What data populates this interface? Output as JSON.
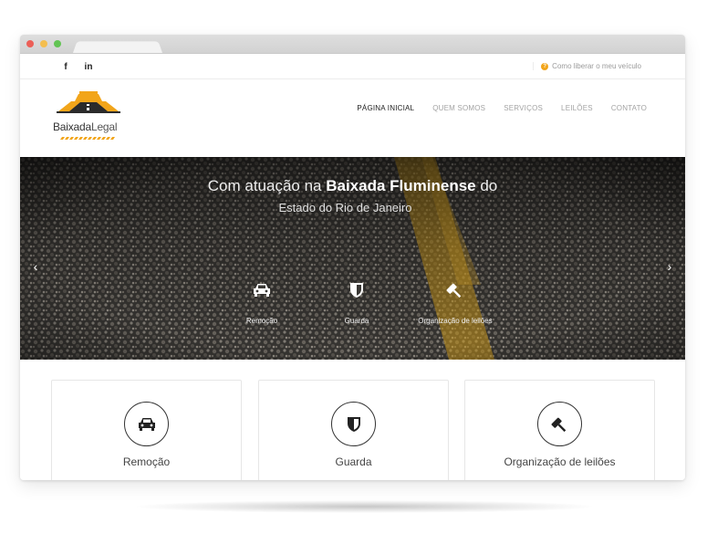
{
  "topbar": {
    "social": [
      {
        "name": "facebook-icon",
        "glyph": "f"
      },
      {
        "name": "linkedin-icon",
        "glyph": "in"
      }
    ],
    "help_link": "Como liberar o meu veículo",
    "help_icon": "?"
  },
  "logo": {
    "text_bold": "Baixada",
    "text_light": "Legal"
  },
  "nav": {
    "items": [
      "PÁGINA INICIAL",
      "QUEM SOMOS",
      "SERVIÇOS",
      "LEILÕES",
      "CONTATO"
    ],
    "active_index": 0
  },
  "hero": {
    "title_pre": "Com atuação na ",
    "title_bold": "Baixada Fluminense",
    "title_post": " do",
    "subtitle": "Estado do Rio de Janeiro",
    "prev": "‹",
    "next": "›",
    "features": [
      {
        "label": "Remoção",
        "icon": "car-icon"
      },
      {
        "label": "Guarda",
        "icon": "shield-icon"
      },
      {
        "label": "Organização de leilões",
        "icon": "gavel-icon"
      }
    ]
  },
  "services": [
    {
      "label": "Remoção",
      "icon": "car-icon"
    },
    {
      "label": "Guarda",
      "icon": "shield-icon"
    },
    {
      "label": "Organização de leilões",
      "icon": "gavel-icon"
    }
  ],
  "colors": {
    "accent": "#f2a51a",
    "nav_active": "#222222",
    "nav_inactive": "#a3a3a3",
    "road_stripe": "#d9a21c"
  }
}
